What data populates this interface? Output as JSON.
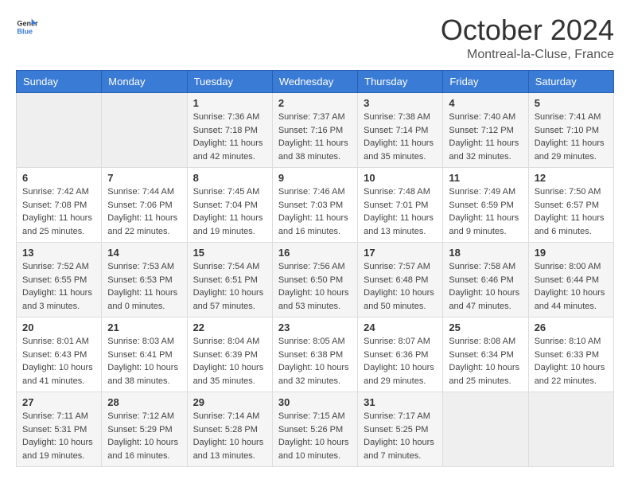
{
  "logo": {
    "general": "General",
    "blue": "Blue"
  },
  "header": {
    "month": "October 2024",
    "location": "Montreal-la-Cluse, France"
  },
  "weekdays": [
    "Sunday",
    "Monday",
    "Tuesday",
    "Wednesday",
    "Thursday",
    "Friday",
    "Saturday"
  ],
  "weeks": [
    [
      {
        "day": "",
        "sunrise": "",
        "sunset": "",
        "daylight": ""
      },
      {
        "day": "",
        "sunrise": "",
        "sunset": "",
        "daylight": ""
      },
      {
        "day": "1",
        "sunrise": "Sunrise: 7:36 AM",
        "sunset": "Sunset: 7:18 PM",
        "daylight": "Daylight: 11 hours and 42 minutes."
      },
      {
        "day": "2",
        "sunrise": "Sunrise: 7:37 AM",
        "sunset": "Sunset: 7:16 PM",
        "daylight": "Daylight: 11 hours and 38 minutes."
      },
      {
        "day": "3",
        "sunrise": "Sunrise: 7:38 AM",
        "sunset": "Sunset: 7:14 PM",
        "daylight": "Daylight: 11 hours and 35 minutes."
      },
      {
        "day": "4",
        "sunrise": "Sunrise: 7:40 AM",
        "sunset": "Sunset: 7:12 PM",
        "daylight": "Daylight: 11 hours and 32 minutes."
      },
      {
        "day": "5",
        "sunrise": "Sunrise: 7:41 AM",
        "sunset": "Sunset: 7:10 PM",
        "daylight": "Daylight: 11 hours and 29 minutes."
      }
    ],
    [
      {
        "day": "6",
        "sunrise": "Sunrise: 7:42 AM",
        "sunset": "Sunset: 7:08 PM",
        "daylight": "Daylight: 11 hours and 25 minutes."
      },
      {
        "day": "7",
        "sunrise": "Sunrise: 7:44 AM",
        "sunset": "Sunset: 7:06 PM",
        "daylight": "Daylight: 11 hours and 22 minutes."
      },
      {
        "day": "8",
        "sunrise": "Sunrise: 7:45 AM",
        "sunset": "Sunset: 7:04 PM",
        "daylight": "Daylight: 11 hours and 19 minutes."
      },
      {
        "day": "9",
        "sunrise": "Sunrise: 7:46 AM",
        "sunset": "Sunset: 7:03 PM",
        "daylight": "Daylight: 11 hours and 16 minutes."
      },
      {
        "day": "10",
        "sunrise": "Sunrise: 7:48 AM",
        "sunset": "Sunset: 7:01 PM",
        "daylight": "Daylight: 11 hours and 13 minutes."
      },
      {
        "day": "11",
        "sunrise": "Sunrise: 7:49 AM",
        "sunset": "Sunset: 6:59 PM",
        "daylight": "Daylight: 11 hours and 9 minutes."
      },
      {
        "day": "12",
        "sunrise": "Sunrise: 7:50 AM",
        "sunset": "Sunset: 6:57 PM",
        "daylight": "Daylight: 11 hours and 6 minutes."
      }
    ],
    [
      {
        "day": "13",
        "sunrise": "Sunrise: 7:52 AM",
        "sunset": "Sunset: 6:55 PM",
        "daylight": "Daylight: 11 hours and 3 minutes."
      },
      {
        "day": "14",
        "sunrise": "Sunrise: 7:53 AM",
        "sunset": "Sunset: 6:53 PM",
        "daylight": "Daylight: 11 hours and 0 minutes."
      },
      {
        "day": "15",
        "sunrise": "Sunrise: 7:54 AM",
        "sunset": "Sunset: 6:51 PM",
        "daylight": "Daylight: 10 hours and 57 minutes."
      },
      {
        "day": "16",
        "sunrise": "Sunrise: 7:56 AM",
        "sunset": "Sunset: 6:50 PM",
        "daylight": "Daylight: 10 hours and 53 minutes."
      },
      {
        "day": "17",
        "sunrise": "Sunrise: 7:57 AM",
        "sunset": "Sunset: 6:48 PM",
        "daylight": "Daylight: 10 hours and 50 minutes."
      },
      {
        "day": "18",
        "sunrise": "Sunrise: 7:58 AM",
        "sunset": "Sunset: 6:46 PM",
        "daylight": "Daylight: 10 hours and 47 minutes."
      },
      {
        "day": "19",
        "sunrise": "Sunrise: 8:00 AM",
        "sunset": "Sunset: 6:44 PM",
        "daylight": "Daylight: 10 hours and 44 minutes."
      }
    ],
    [
      {
        "day": "20",
        "sunrise": "Sunrise: 8:01 AM",
        "sunset": "Sunset: 6:43 PM",
        "daylight": "Daylight: 10 hours and 41 minutes."
      },
      {
        "day": "21",
        "sunrise": "Sunrise: 8:03 AM",
        "sunset": "Sunset: 6:41 PM",
        "daylight": "Daylight: 10 hours and 38 minutes."
      },
      {
        "day": "22",
        "sunrise": "Sunrise: 8:04 AM",
        "sunset": "Sunset: 6:39 PM",
        "daylight": "Daylight: 10 hours and 35 minutes."
      },
      {
        "day": "23",
        "sunrise": "Sunrise: 8:05 AM",
        "sunset": "Sunset: 6:38 PM",
        "daylight": "Daylight: 10 hours and 32 minutes."
      },
      {
        "day": "24",
        "sunrise": "Sunrise: 8:07 AM",
        "sunset": "Sunset: 6:36 PM",
        "daylight": "Daylight: 10 hours and 29 minutes."
      },
      {
        "day": "25",
        "sunrise": "Sunrise: 8:08 AM",
        "sunset": "Sunset: 6:34 PM",
        "daylight": "Daylight: 10 hours and 25 minutes."
      },
      {
        "day": "26",
        "sunrise": "Sunrise: 8:10 AM",
        "sunset": "Sunset: 6:33 PM",
        "daylight": "Daylight: 10 hours and 22 minutes."
      }
    ],
    [
      {
        "day": "27",
        "sunrise": "Sunrise: 7:11 AM",
        "sunset": "Sunset: 5:31 PM",
        "daylight": "Daylight: 10 hours and 19 minutes."
      },
      {
        "day": "28",
        "sunrise": "Sunrise: 7:12 AM",
        "sunset": "Sunset: 5:29 PM",
        "daylight": "Daylight: 10 hours and 16 minutes."
      },
      {
        "day": "29",
        "sunrise": "Sunrise: 7:14 AM",
        "sunset": "Sunset: 5:28 PM",
        "daylight": "Daylight: 10 hours and 13 minutes."
      },
      {
        "day": "30",
        "sunrise": "Sunrise: 7:15 AM",
        "sunset": "Sunset: 5:26 PM",
        "daylight": "Daylight: 10 hours and 10 minutes."
      },
      {
        "day": "31",
        "sunrise": "Sunrise: 7:17 AM",
        "sunset": "Sunset: 5:25 PM",
        "daylight": "Daylight: 10 hours and 7 minutes."
      },
      {
        "day": "",
        "sunrise": "",
        "sunset": "",
        "daylight": ""
      },
      {
        "day": "",
        "sunrise": "",
        "sunset": "",
        "daylight": ""
      }
    ]
  ]
}
